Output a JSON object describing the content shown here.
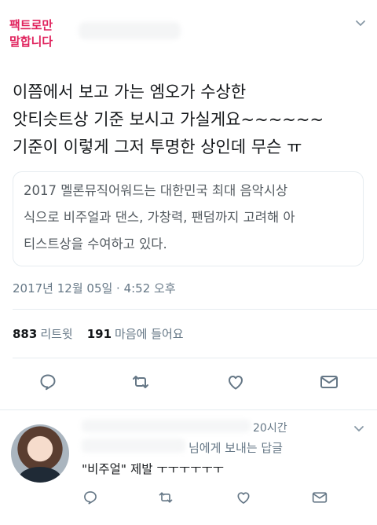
{
  "tweet": {
    "author_name_line1": "팩트로만",
    "author_name_line2": "말합니다",
    "text_lines": [
      "이쯤에서 보고 가는 엠오가 수상한",
      "앗티슷트상 기준 보시고 가실게요~~~~~~",
      "기준이 이렇게 그저 투명한 상인데 무슨 ㅠ"
    ],
    "quote_lines": [
      "2017 멜론뮤직어워드는 대한민국 최대 음악시상",
      "식으로 비주얼과 댄스, 가창력, 팬덤까지 고려해 아",
      "티스트상을 수여하고 있다."
    ],
    "timestamp": "2017년 12월 05일 · 4:52 오후",
    "retweet_count": "883",
    "retweet_label": "리트윗",
    "like_count": "191",
    "like_label": "마음에 들어요",
    "actions": [
      "reply-icon",
      "retweet-icon",
      "heart-icon",
      "message-icon"
    ],
    "accent_color": "#e0245e"
  },
  "reply": {
    "time": "20시간",
    "reply_to": "님에게 보내는 답글",
    "text": "\"비주얼\" 제발 ㅜㅜㅜㅜㅜㅜ",
    "actions": [
      "reply-icon",
      "retweet-icon",
      "heart-icon",
      "message-icon"
    ]
  }
}
